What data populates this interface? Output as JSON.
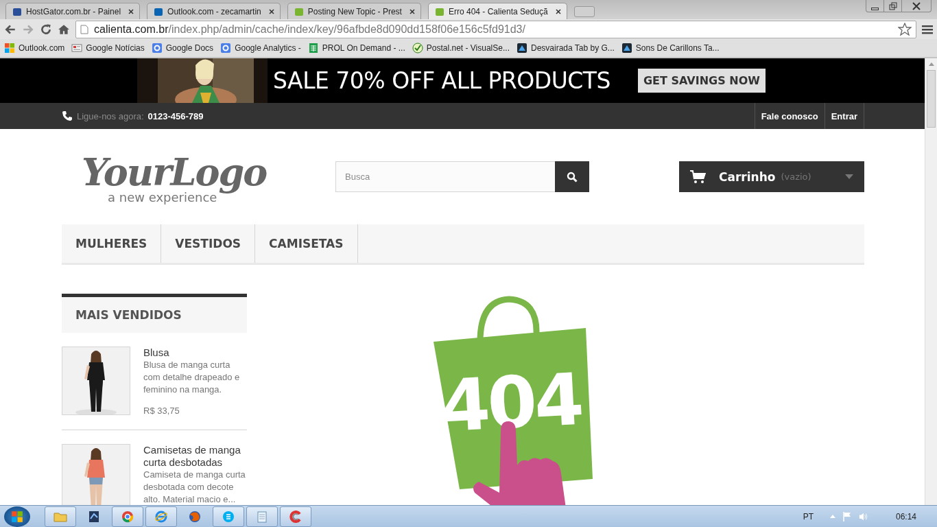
{
  "browser": {
    "tabs": [
      {
        "title": "HostGator.com.br - Painel",
        "selected": false
      },
      {
        "title": "Outlook.com - zecamartin",
        "selected": false
      },
      {
        "title": "Posting New Topic - Prest",
        "selected": false
      },
      {
        "title": "Erro 404 - Calienta Seduçã",
        "selected": true
      }
    ],
    "address": {
      "host": "calienta.com.br",
      "path": "/index.php/admin/cache/index/key/96afbde8d090dd158f06e156c5fd91d3/"
    },
    "bookmarks": [
      {
        "label": "Outlook.com",
        "kind": "windows"
      },
      {
        "label": "Google Notícias",
        "kind": "news"
      },
      {
        "label": "Google Docs",
        "kind": "g"
      },
      {
        "label": "Google Analytics -",
        "kind": "g"
      },
      {
        "label": "PROL On Demand - ...",
        "kind": "sheet"
      },
      {
        "label": "Postal.net - VisualSe...",
        "kind": "check"
      },
      {
        "label": "Desvairada Tab by G...",
        "kind": "theme"
      },
      {
        "label": "Sons De Carillons Ta...",
        "kind": "theme"
      }
    ]
  },
  "page": {
    "banner": {
      "headline": "SALE 70% OFF ALL PRODUCTS",
      "button": "GET SAVINGS NOW"
    },
    "top_bar": {
      "call_label": "Ligue-nos agora:",
      "phone": "0123-456-789",
      "links": [
        "Fale conosco",
        "Entrar"
      ]
    },
    "logo": {
      "name": "YourLogo",
      "tagline": "a new experience"
    },
    "search": {
      "placeholder": "Busca"
    },
    "cart": {
      "label": "Carrinho",
      "status": "(vazio)"
    },
    "menu": [
      {
        "label": "MULHERES"
      },
      {
        "label": "VESTIDOS"
      },
      {
        "label": "CAMISETAS"
      }
    ],
    "sidebar": {
      "title": "MAIS VENDIDOS",
      "products": [
        {
          "name": "Blusa",
          "description": "Blusa de manga curta com detalhe drapeado e feminino na manga.",
          "price": "R$ 33,75",
          "kind": "dark"
        },
        {
          "name": "Camisetas de manga curta desbotadas",
          "description": "Camiseta de manga curta desbotada com decote alto. Material macio e...",
          "kind": "coral"
        }
      ]
    },
    "error_code": "404"
  },
  "taskbar": {
    "language": "PT",
    "time": "06:14"
  }
}
